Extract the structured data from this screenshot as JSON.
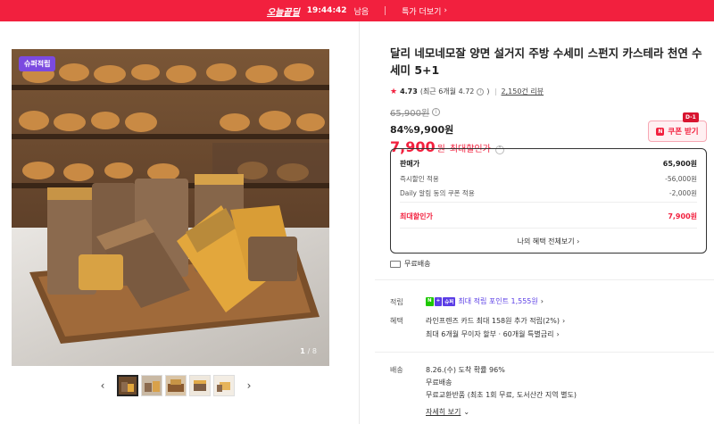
{
  "banner": {
    "brand": "오늘끝딜",
    "timer": "19:44:42",
    "timer_suffix": "남음",
    "deals_label": "특가 더보기"
  },
  "gallery": {
    "badge": "슈퍼적립",
    "counter_current": "1",
    "counter_total": "/ 8",
    "thumbnail_count": 5
  },
  "product": {
    "title": "달리 네모네모잘 양면 설거지 주방 수세미 스펀지 카스테라 천연 수세미 5+1",
    "rating": "4.73",
    "rating_detail": "(최근 6개월 4.72",
    "rating_detail_close": ")",
    "review_count": "2,150건 리뷰",
    "original_price": "65,900원",
    "discount_line": "84%9,900원",
    "best_price_num": "7,900",
    "best_price_unit": "원",
    "best_price_label": "최대할인가"
  },
  "coupon": {
    "label": "쿠폰 받기",
    "dday": "D-1",
    "logo": "N"
  },
  "price_box": {
    "sale_label": "판매가",
    "sale_value": "65,900원",
    "instant_label": "즉시할인 적용",
    "instant_value": "-56,000원",
    "coupon_label": "Daily 알림 동의 쿠폰 적용",
    "coupon_value": "-2,000원",
    "max_label": "최대할인가",
    "max_value": "7,900원",
    "more_benefits": "나의 혜택 전체보기"
  },
  "shipping_tag": "무료배송",
  "points": {
    "label": "적립",
    "text": "최대 적립 포인트 1,555원"
  },
  "benefits": {
    "label": "혜택",
    "line1": "라인프렌즈 카드 최대 158원 추가 적립(2%)",
    "line2": "최대 6개월 무이자 할부 · 60개월 특별금리"
  },
  "delivery": {
    "label": "배송",
    "line1": "8.26.(수) 도착 확률 96%",
    "line2": "무료배송",
    "line3": "무료교환반품 (최초 1회 무료, 도서산간 지역 별도)",
    "detail_link": "자세히 보기"
  },
  "colors": {
    "accent_red": "#f2203e",
    "badge_purple": "#7b4ae0",
    "point_purple": "#5b3ee6"
  }
}
